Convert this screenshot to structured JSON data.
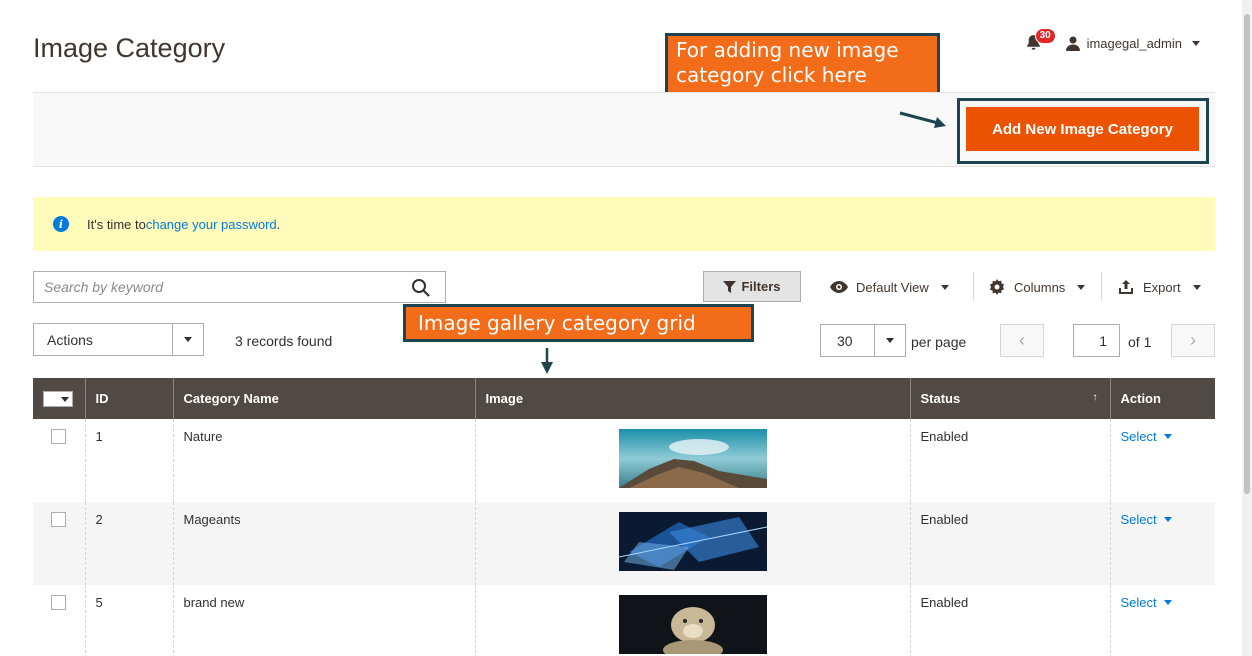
{
  "page": {
    "title": "Image Category"
  },
  "header": {
    "notifications_count": "30",
    "username": "imagegal_admin"
  },
  "actions": {
    "add_button_label": "Add New Image Category"
  },
  "callouts": {
    "add_line1": "For adding new image",
    "add_line2": "category click here",
    "grid": "Image gallery category grid"
  },
  "notice": {
    "prefix": "It's time to ",
    "link": "change your password",
    "suffix": "."
  },
  "toolbar": {
    "search_placeholder": "Search by keyword",
    "filters_label": "Filters",
    "default_view_label": "Default View",
    "columns_label": "Columns",
    "export_label": "Export",
    "mass_actions_label": "Actions",
    "records_found": "3 records found",
    "per_page_value": "30",
    "per_page_label": "per page",
    "page_current": "1",
    "page_total_label": "of 1"
  },
  "grid": {
    "columns": [
      "ID",
      "Category Name",
      "Image",
      "Status",
      "Action"
    ],
    "rows": [
      {
        "id": "1",
        "name": "Nature",
        "status": "Enabled",
        "action": "Select"
      },
      {
        "id": "2",
        "name": "Mageants",
        "status": "Enabled",
        "action": "Select"
      },
      {
        "id": "5",
        "name": "brand new",
        "status": "Enabled",
        "action": "Select"
      }
    ]
  },
  "colors": {
    "accent_orange": "#eb5202",
    "callout_orange": "#f36c1a",
    "callout_border": "#1e4450",
    "grid_header": "#514943",
    "link_blue": "#007bdb",
    "notice_bg": "#fffbbb"
  }
}
